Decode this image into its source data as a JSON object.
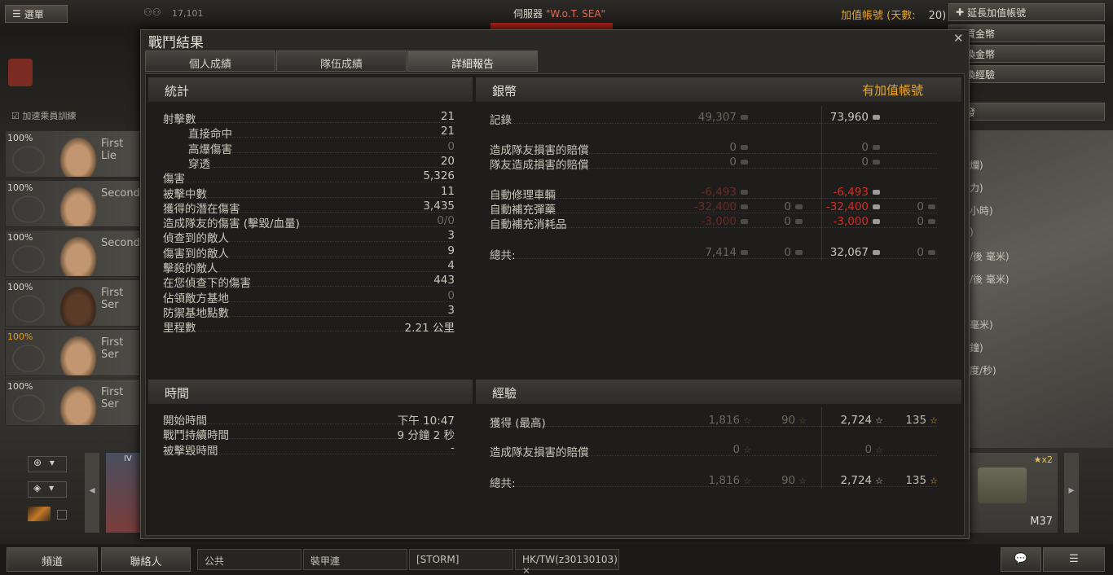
{
  "topbar": {
    "menu_label": "選單",
    "players_online": "17,101",
    "server_label": "伺服器",
    "server_name": "\"W.o.T. SEA\"",
    "premium_label": "加值帳號 (天數:",
    "premium_days": "20)",
    "extend_premium": "延長加值帳號",
    "buy_gold": "購買金幣",
    "exchange_gold": "兌換金幣",
    "convert_xp": "轉換經驗",
    "research": "研發"
  },
  "side_stats": [
    "爛)",
    "力)",
    "小時)",
    ")",
    "/後 毫米)",
    "/後 毫米)",
    "毫米)",
    "鐘)",
    "度/秒)"
  ],
  "crew": {
    "accelerate_label": "加速乘員訓練",
    "members": [
      {
        "pct": "100%",
        "name": "First Lie"
      },
      {
        "pct": "100%",
        "name": "Second"
      },
      {
        "pct": "100%",
        "name": "Second"
      },
      {
        "pct": "100%",
        "name": "First Ser"
      },
      {
        "pct": "100%",
        "name": "First Ser"
      },
      {
        "pct": "100%",
        "name": "First Ser"
      }
    ]
  },
  "dialog": {
    "title": "戰鬥結果",
    "close": "✕",
    "tabs": [
      "個人成績",
      "隊伍成績",
      "詳細報告"
    ]
  },
  "stats": {
    "header": "統計",
    "rows": [
      {
        "label": "射擊數",
        "value": "21",
        "indent": false,
        "dim": false
      },
      {
        "label": "直接命中",
        "value": "21",
        "indent": true,
        "dim": false
      },
      {
        "label": "高爆傷害",
        "value": "0",
        "indent": true,
        "dim": true
      },
      {
        "label": "穿透",
        "value": "20",
        "indent": true,
        "dim": false
      },
      {
        "label": "傷害",
        "value": "5,326",
        "indent": false,
        "dim": false
      },
      {
        "label": "被擊中數",
        "value": "11",
        "indent": false,
        "dim": false
      },
      {
        "label": "獲得的潛在傷害",
        "value": "3,435",
        "indent": false,
        "dim": false
      },
      {
        "label": "造成隊友的傷害 (擊毀/血量)",
        "value": "0/0",
        "indent": false,
        "dim": true
      },
      {
        "label": "偵查到的敵人",
        "value": "3",
        "indent": false,
        "dim": false
      },
      {
        "label": "傷害到的敵人",
        "value": "9",
        "indent": false,
        "dim": false
      },
      {
        "label": "擊殺的敵人",
        "value": "4",
        "indent": false,
        "dim": false
      },
      {
        "label": "在您偵查下的傷害",
        "value": "443",
        "indent": false,
        "dim": false
      },
      {
        "label": "佔領敵方基地",
        "value": "0",
        "indent": false,
        "dim": true
      },
      {
        "label": "防禦基地點數",
        "value": "3",
        "indent": false,
        "dim": false
      },
      {
        "label": "里程數",
        "value": "2.21 公里",
        "indent": false,
        "dim": false
      }
    ]
  },
  "time": {
    "header": "時間",
    "rows": [
      {
        "label": "開始時間",
        "value": "下午 10:47"
      },
      {
        "label": "戰鬥持續時間",
        "value": "9 分鐘 2 秒"
      },
      {
        "label": "被擊毀時間",
        "value": "-"
      }
    ]
  },
  "credits": {
    "header": "銀幣",
    "premium_header": "有加值帳號",
    "rows": [
      {
        "label": "記錄",
        "base": "49,307",
        "base_gold": "",
        "prem": "73,960",
        "prem_gold": "",
        "red": false
      },
      {
        "label": "造成隊友損害的賠償",
        "base": "0",
        "base_gold": "",
        "prem": "0",
        "prem_gold": "",
        "red": false
      },
      {
        "label": "隊友造成損害的賠償",
        "base": "0",
        "base_gold": "",
        "prem": "0",
        "prem_gold": "",
        "red": false
      },
      {
        "label": "自動修理車輛",
        "base": "-6,493",
        "base_gold": "",
        "prem": "-6,493",
        "prem_gold": "",
        "red": true
      },
      {
        "label": "自動補充彈藥",
        "base": "-32,400",
        "base_gold": "0",
        "prem": "-32,400",
        "prem_gold": "0",
        "red": true
      },
      {
        "label": "自動補充消耗品",
        "base": "-3,000",
        "base_gold": "0",
        "prem": "-3,000",
        "prem_gold": "0",
        "red": true
      },
      {
        "label": "總共:",
        "base": "7,414",
        "base_gold": "0",
        "prem": "32,067",
        "prem_gold": "0",
        "red": false
      }
    ]
  },
  "xp": {
    "header": "經驗",
    "rows": [
      {
        "label": "獲得 (最高)",
        "base": "1,816",
        "base_free": "90",
        "prem": "2,724",
        "prem_free": "135"
      },
      {
        "label": "造成隊友損害的賠償",
        "base": "0",
        "base_free": "",
        "prem": "0",
        "prem_free": ""
      },
      {
        "label": "總共:",
        "base": "1,816",
        "base_free": "90",
        "prem": "2,724",
        "prem_free": "135"
      }
    ]
  },
  "carousel": {
    "tier": "IV",
    "tank_name": "M37",
    "badge": "x2"
  },
  "bottom": {
    "channels_btn": "頻道",
    "contacts_btn": "聯絡人",
    "channels": [
      "公共",
      "裝甲連",
      "[STORM]",
      "HK/TW(z30130103)"
    ]
  }
}
